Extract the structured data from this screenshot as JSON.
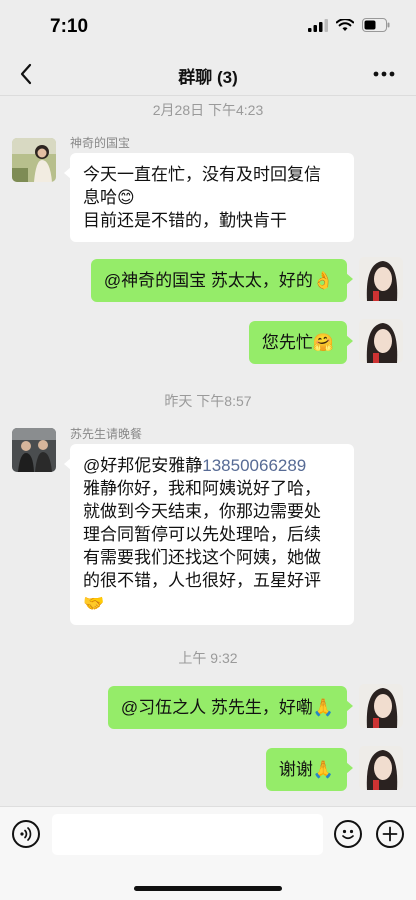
{
  "status": {
    "time": "7:10"
  },
  "nav": {
    "title": "群聊 (3)"
  },
  "timestamps": [
    "2月28日 下午4:23",
    "昨天 下午8:57",
    "上午 9:32"
  ],
  "messages": [
    {
      "side": "left",
      "sender": "神奇的国宝",
      "lines": [
        "今天一直在忙，没有及时回复信",
        "息哈😊",
        "目前还是不错的，勤快肯干"
      ]
    },
    {
      "side": "right",
      "text": "@神奇的国宝 苏太太，好的👌"
    },
    {
      "side": "right",
      "text": "您先忙🤗"
    },
    {
      "side": "left",
      "sender": "苏先生请晚餐",
      "mention": "@好邦伲安雅静",
      "phone": "13850066289",
      "lines": [
        "雅静你好，我和阿姨说好了哈，",
        "就做到今天结束，你那边需要处",
        "理合同暂停可以先处理哈，后续",
        "有需要我们还找这个阿姨，她做",
        "的很不错，人也很好，五星好评",
        "🤝"
      ]
    },
    {
      "side": "right",
      "text": "@习伍之人 苏先生，好嘞🙏"
    },
    {
      "side": "right",
      "text": "谢谢🙏"
    }
  ],
  "input": {
    "placeholder": ""
  },
  "icons": {
    "back": "chevron-left-icon",
    "more": "more-dots-icon",
    "voice": "voice-icon",
    "emoji": "emoji-icon",
    "plus": "plus-icon"
  },
  "colors": {
    "right_bubble": "#95ec69",
    "left_bubble": "#ffffff",
    "background": "#ededed",
    "link": "#576b95"
  }
}
